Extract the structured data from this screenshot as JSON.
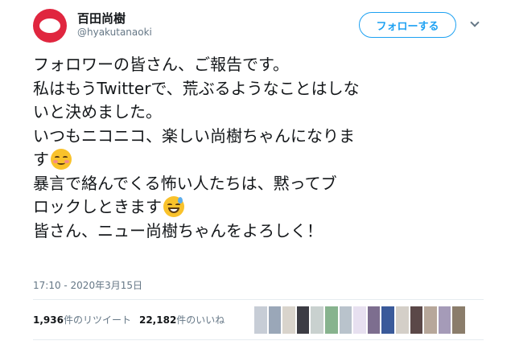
{
  "user": {
    "display_name": "百田尚樹",
    "handle": "@hyakutanaoki",
    "avatar_color": "#e0263f"
  },
  "follow_button": {
    "label": "フォローする"
  },
  "menu_icon": "chevron-down-icon",
  "tweet": {
    "lines": [
      "フォロワーの皆さん、ご報告です。",
      "私はもうTwitterで、荒ぶるようなことはしな",
      "いと決めました。",
      "いつもニコニコ、楽しい尚樹ちゃんになりま",
      "す",
      "暴言で絡んでくる怖い人たちは、黙ってブ",
      "ロックしときます",
      "皆さん、ニュー尚樹ちゃんをよろしく！"
    ],
    "emojis": [
      "smiling-face-with-blush-icon",
      "grinning-face-with-sweat-icon"
    ]
  },
  "timestamp": "17:10 - 2020年3月15日",
  "stats": {
    "retweets_count": "1,936",
    "retweets_label": "件のリツイート",
    "likes_count": "22,182",
    "likes_label": "件のいいね"
  },
  "liker_colors": [
    "#c7cdd6",
    "#9aa7b8",
    "#d9d4cc",
    "#3c3c44",
    "#c9d1cf",
    "#87b38e",
    "#b9c3cc",
    "#e7e0f0",
    "#7d6e8f",
    "#3a5a9a",
    "#d4cfc8",
    "#5b4848",
    "#b7a79a",
    "#a59bb8",
    "#8b7d6b"
  ]
}
